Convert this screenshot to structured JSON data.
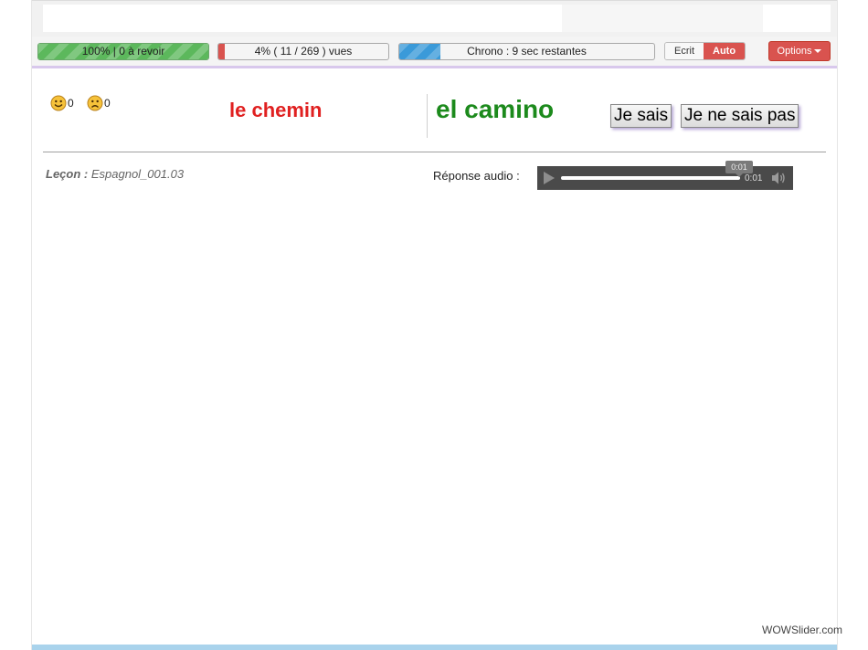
{
  "toolbar": {
    "review_bar": {
      "text": "100%  |  0 à revoir",
      "progress": 1.0,
      "color": "#5cb85c"
    },
    "views_bar": {
      "text": "4% ( 11 / 269 ) vues",
      "progress": 0.04,
      "color": "#d9534f"
    },
    "chrono_bar": {
      "text": "Chrono : 9 sec restantes",
      "progress": 0.16,
      "color": "#3a9ad9"
    },
    "mode": {
      "written": "Ecrit",
      "auto": "Auto",
      "active": "auto"
    },
    "options_label": "Options"
  },
  "counters": {
    "happy": {
      "icon": "smiley-happy-icon",
      "count": "0"
    },
    "sad": {
      "icon": "smiley-sad-icon",
      "count": "0"
    }
  },
  "card": {
    "question": "le chemin",
    "answer": "el camino",
    "question_color": "#e02020",
    "answer_color": "#1c8a1c"
  },
  "actions": {
    "know": "Je sais",
    "dont_know": "Je ne sais pas"
  },
  "lesson": {
    "label": "Leçon :",
    "name": "Espagnol_001.03"
  },
  "audio": {
    "label": "Réponse audio :",
    "current_time": "0:01",
    "tooltip_time": "0:01",
    "progress": 1.0
  },
  "watermark": "WOWSlider.com"
}
